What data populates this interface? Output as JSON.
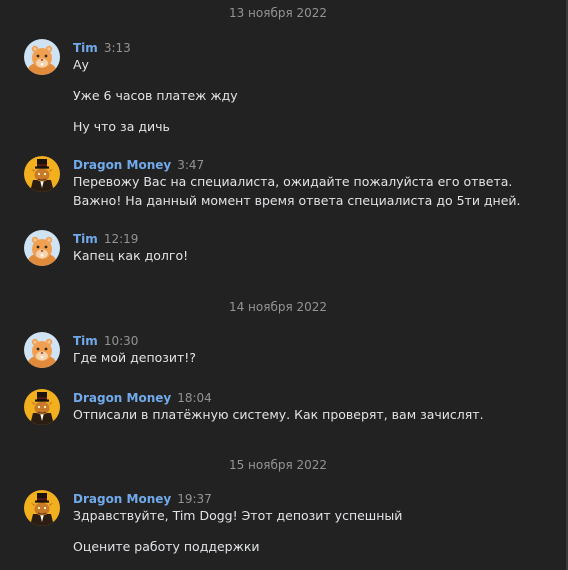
{
  "colors": {
    "background": "#222222",
    "author": "#71aaeb",
    "text": "#e1e3e6",
    "muted": "#939393"
  },
  "dates": [
    "13 ноября 2022",
    "14 ноября 2022",
    "15 ноября 2022"
  ],
  "messages": [
    {
      "author": "Tim",
      "avatar": "hamster-avatar-icon",
      "time": "3:13",
      "lines": [
        "Ау",
        "Уже 6 часов платеж жду",
        "Ну что за дичь"
      ]
    },
    {
      "author": "Dragon Money",
      "avatar": "dragon-money-logo-icon",
      "time": "3:47",
      "lines": [
        "Перевожу Вас на специалиста, ожидайте пожалуйста его ответа.",
        "Важно! На данный момент время ответа специалиста до 5ти дней."
      ]
    },
    {
      "author": "Tim",
      "avatar": "hamster-avatar-icon",
      "time": "12:19",
      "lines": [
        "Капец как долго!"
      ]
    },
    {
      "author": "Tim",
      "avatar": "hamster-avatar-icon",
      "time": "10:30",
      "lines": [
        "Где мой депозит!?"
      ]
    },
    {
      "author": "Dragon Money",
      "avatar": "dragon-money-logo-icon",
      "time": "18:04",
      "lines": [
        "Отписали в платёжную систему. Как проверят, вам зачислят."
      ]
    },
    {
      "author": "Dragon Money",
      "avatar": "dragon-money-logo-icon",
      "time": "19:37",
      "lines": [
        "Здравствуйте, Tim Dogg! Этот депозит успешный",
        "Оцените работу поддержки"
      ]
    }
  ]
}
